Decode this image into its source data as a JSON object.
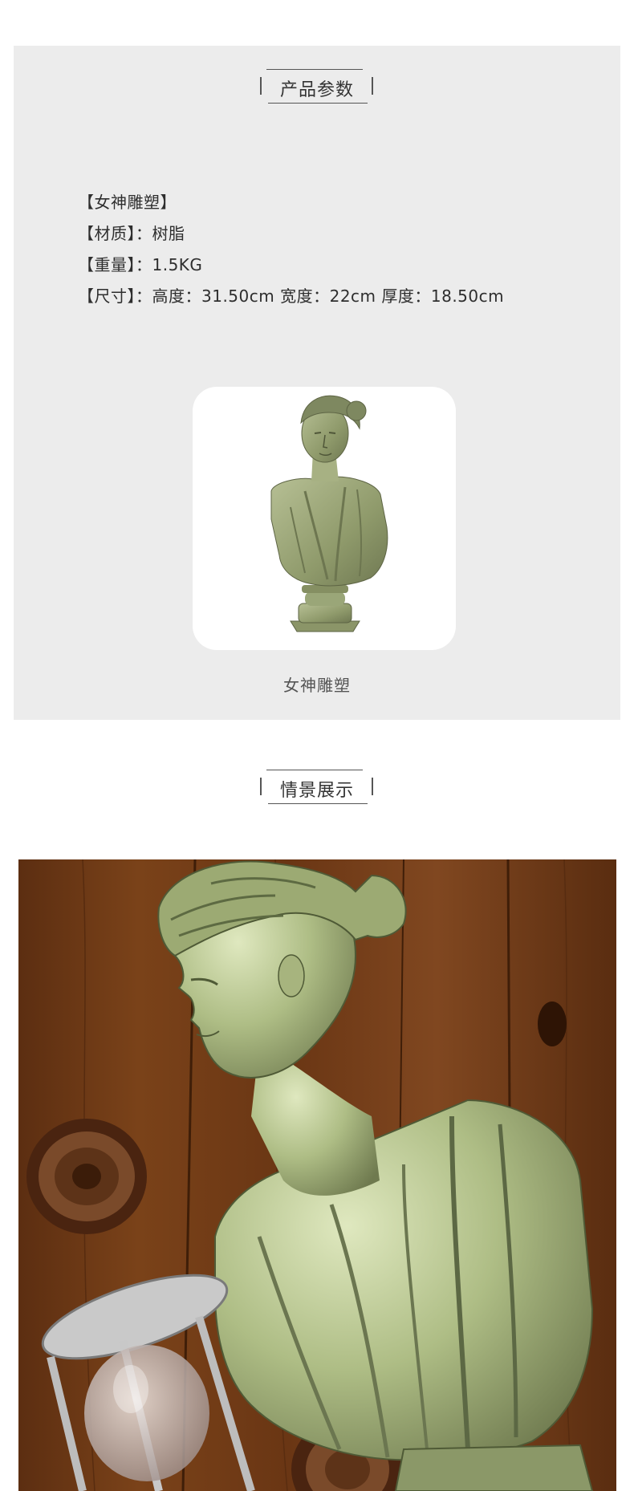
{
  "params": {
    "heading": "产品参数",
    "specs": [
      "【女神雕塑】",
      "【材质】：树脂",
      "【重量】：1.5KG",
      "【尺寸】：高度：31.50cm  宽度：22cm  厚度：18.50cm"
    ],
    "caption": "女神雕塑"
  },
  "scene": {
    "heading": "情景展示"
  },
  "colors": {
    "panel_bg": "#ececec",
    "sculpture_green": "#9aa678",
    "wood_brown": "#6e3a17"
  }
}
